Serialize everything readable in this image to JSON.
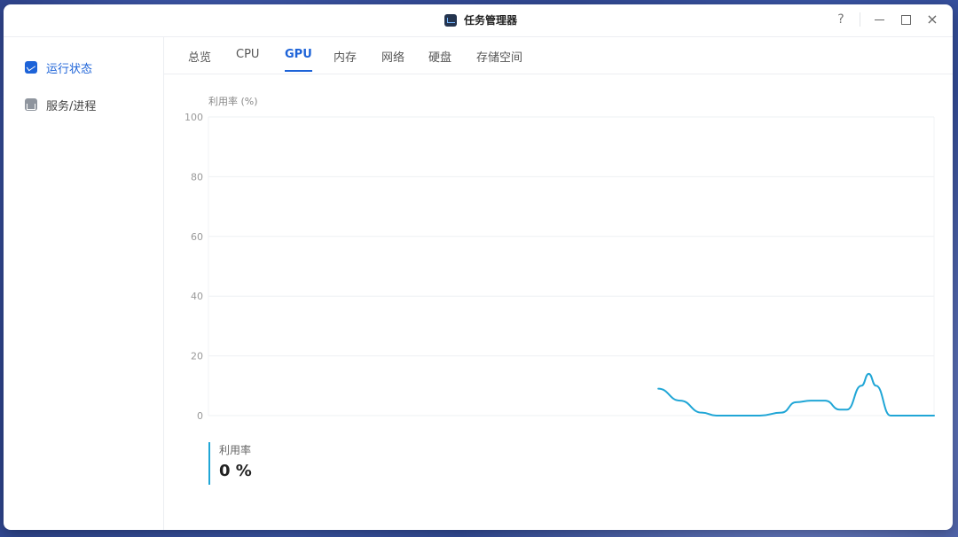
{
  "window": {
    "title": "任务管理器",
    "help_label": "?",
    "close_label": "×"
  },
  "sidebar": {
    "items": [
      {
        "label": "运行状态",
        "icon": "performance-icon",
        "active": true
      },
      {
        "label": "服务/进程",
        "icon": "process-icon",
        "active": false
      }
    ]
  },
  "tabs": [
    {
      "label": "总览",
      "active": false
    },
    {
      "label": "CPU",
      "active": false
    },
    {
      "label": "GPU",
      "active": true
    },
    {
      "label": "内存",
      "active": false
    },
    {
      "label": "网络",
      "active": false
    },
    {
      "label": "硬盘",
      "active": false
    },
    {
      "label": "存储空间",
      "active": false
    }
  ],
  "chart_data": {
    "type": "line",
    "ylabel": "利用率 (%)",
    "ylim": [
      0,
      100
    ],
    "yticks": [
      0,
      20,
      40,
      60,
      80,
      100
    ],
    "grid": true,
    "series": [
      {
        "x": [
          0.62,
          0.65,
          0.68,
          0.7,
          0.73,
          0.76,
          0.79,
          0.81,
          0.83,
          0.85,
          0.87,
          0.88,
          0.9,
          0.91,
          0.92,
          0.94,
          1.0
        ],
        "values": [
          9,
          5,
          1,
          0,
          0,
          0,
          1,
          4.5,
          5,
          5,
          2,
          2,
          10,
          14,
          10,
          0,
          0
        ],
        "color": "#20a6d6"
      }
    ]
  },
  "legend": {
    "label": "利用率",
    "value": "0 %"
  }
}
